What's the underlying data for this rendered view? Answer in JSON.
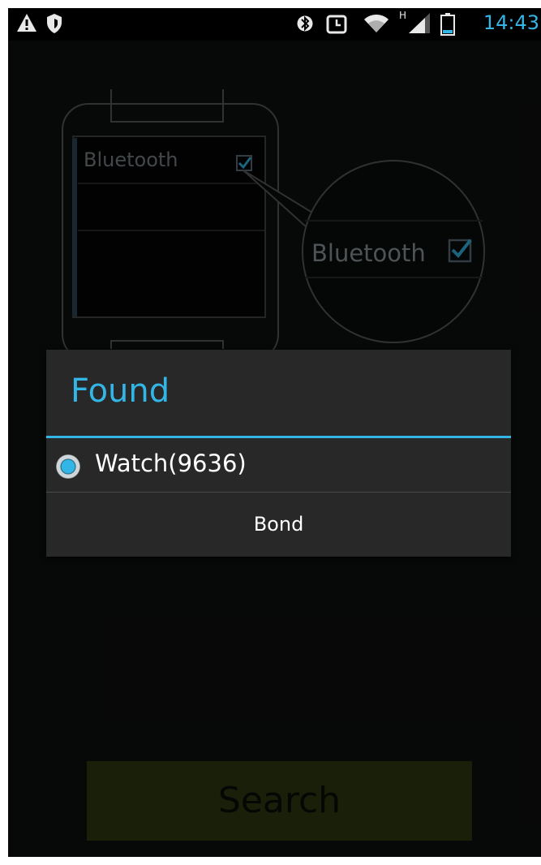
{
  "status_bar": {
    "time": "14:43",
    "network_type_label": "H",
    "icons": [
      "warning-icon",
      "shield-icon",
      "bluetooth-icon",
      "alarm-icon",
      "wifi-icon",
      "cellular-signal-icon",
      "battery-icon"
    ]
  },
  "illustration": {
    "watch_screen_label": "Bluetooth",
    "zoom_label": "Bluetooth"
  },
  "dialog": {
    "title": "Found",
    "device": {
      "name": "Watch(9636)",
      "selected": true
    },
    "bond_label": "Bond"
  },
  "search_label": "Search",
  "colors": {
    "accent": "#33b5e5",
    "search_button_bg": "#2f3a10",
    "dialog_bg": "#282828"
  }
}
